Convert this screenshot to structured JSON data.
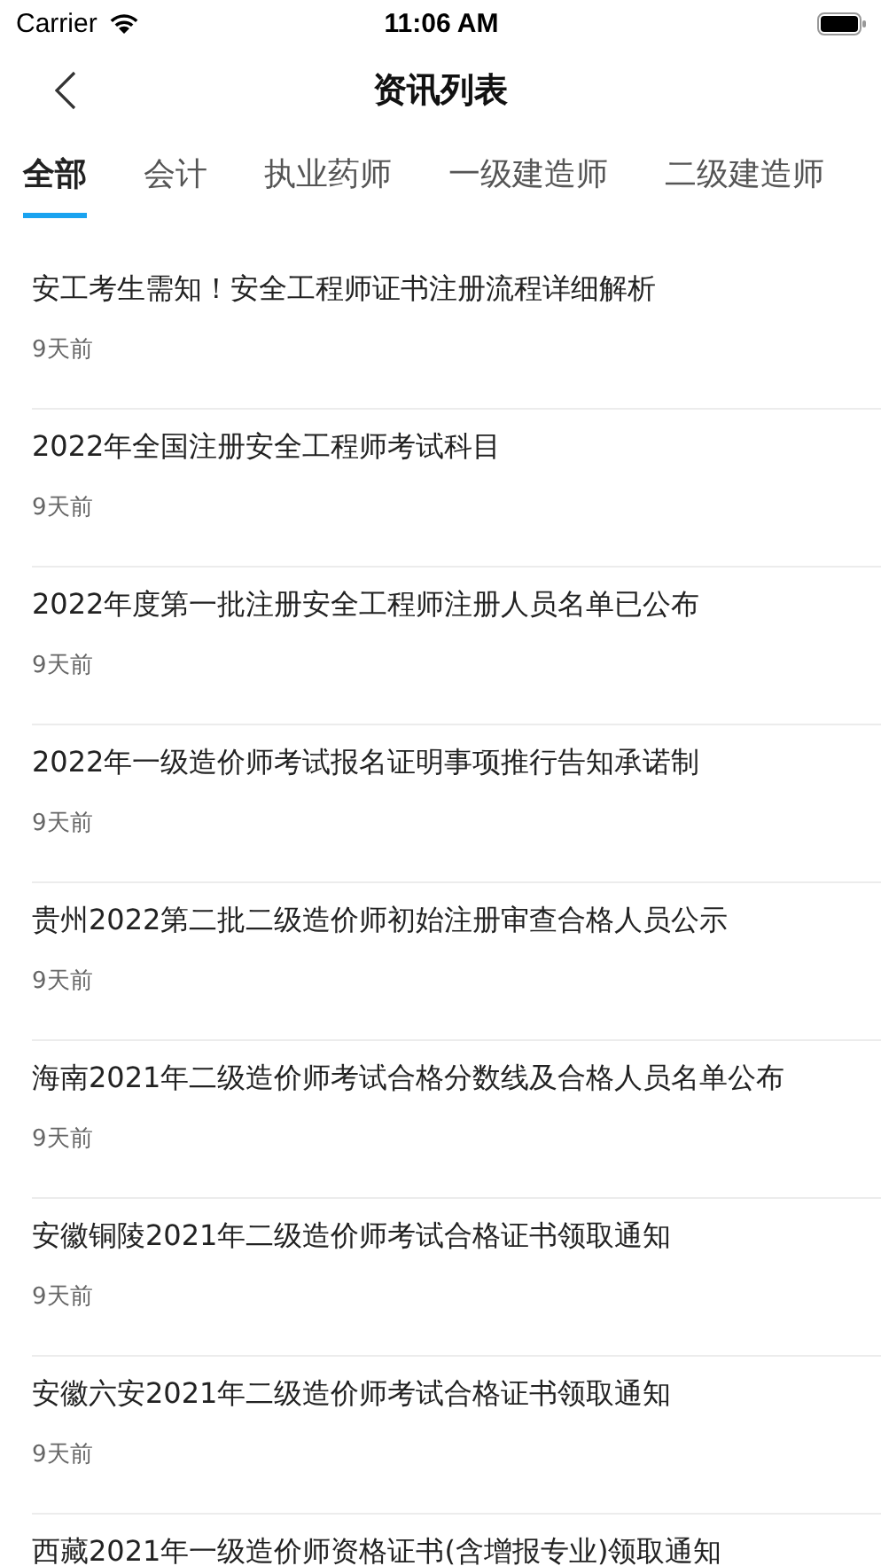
{
  "status_bar": {
    "carrier": "Carrier",
    "time": "11:06 AM"
  },
  "nav": {
    "title": "资讯列表"
  },
  "tabs": [
    {
      "label": "全部",
      "selected": true
    },
    {
      "label": "会计",
      "selected": false
    },
    {
      "label": "执业药师",
      "selected": false
    },
    {
      "label": "一级建造师",
      "selected": false
    },
    {
      "label": "二级建造师",
      "selected": false
    }
  ],
  "articles": [
    {
      "title": "安工考生需知！安全工程师证书注册流程详细解析",
      "time": "9天前"
    },
    {
      "title": "2022年全国注册安全工程师考试科目",
      "time": "9天前"
    },
    {
      "title": "2022年度第一批注册安全工程师注册人员名单已公布",
      "time": "9天前"
    },
    {
      "title": "2022年一级造价师考试报名证明事项推行告知承诺制",
      "time": "9天前"
    },
    {
      "title": "贵州2022第二批二级造价师初始注册审查合格人员公示",
      "time": "9天前"
    },
    {
      "title": "海南2021年二级造价师考试合格分数线及合格人员名单公布",
      "time": "9天前"
    },
    {
      "title": "安徽铜陵2021年二级造价师考试合格证书领取通知",
      "time": "9天前"
    },
    {
      "title": "安徽六安2021年二级造价师考试合格证书领取通知",
      "time": "9天前"
    },
    {
      "title": "西藏2021年一级造价师资格证书(含增报专业)领取通知"
    }
  ]
}
